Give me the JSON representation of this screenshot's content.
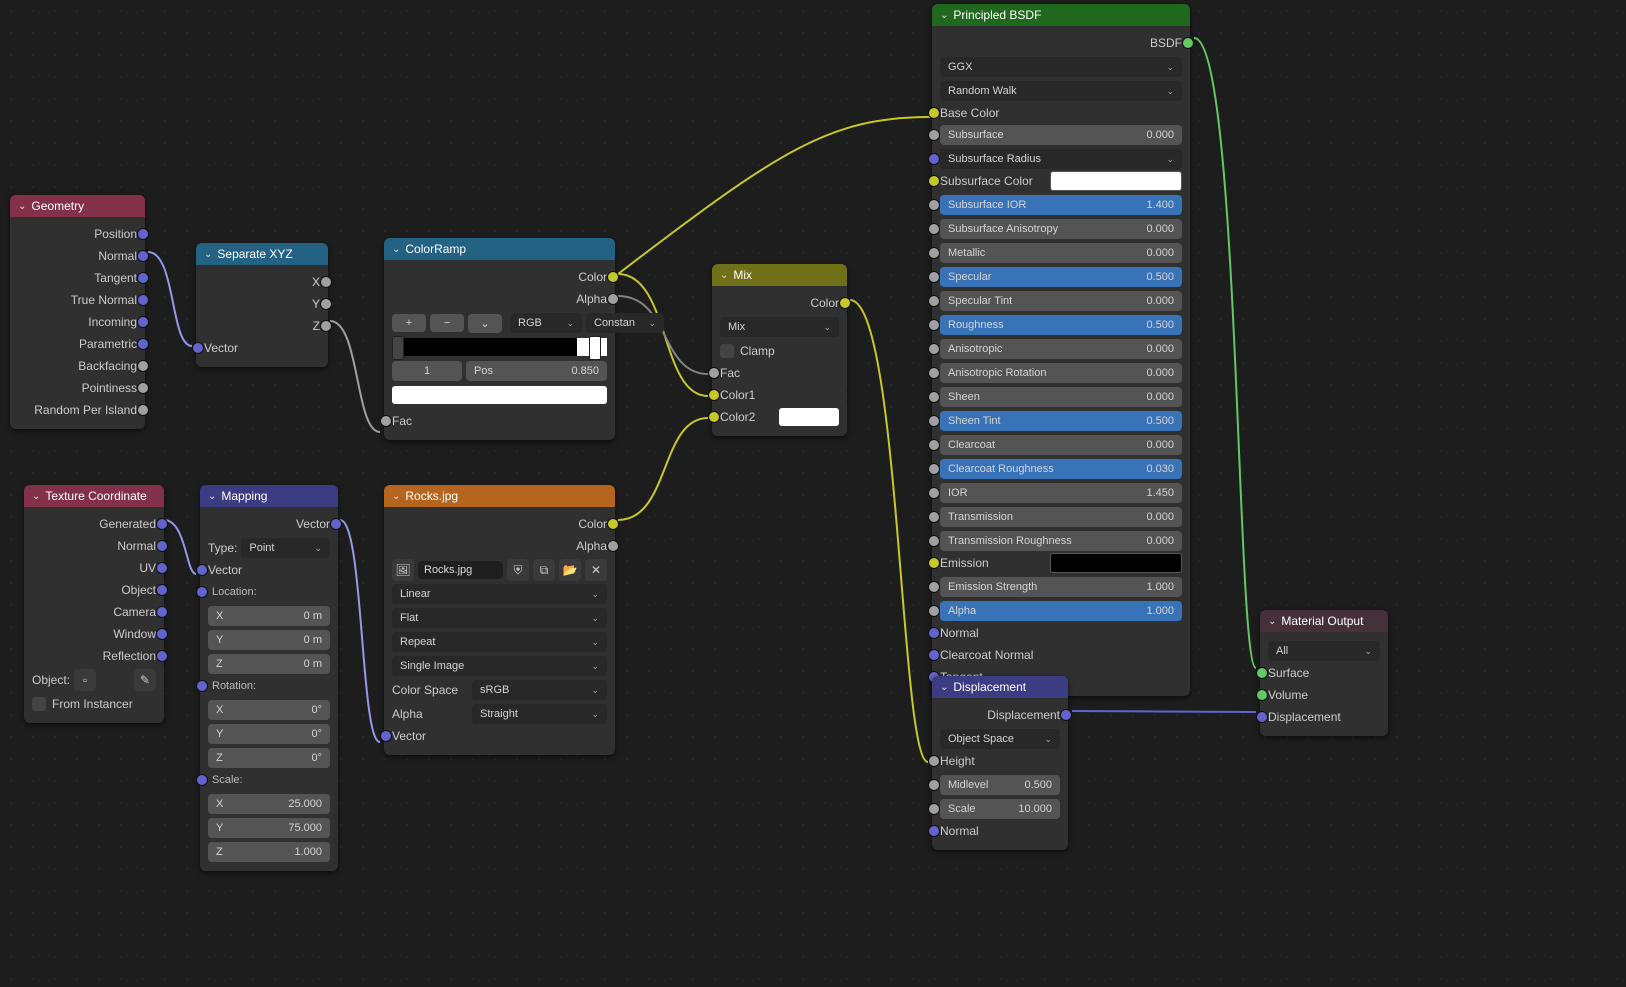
{
  "geometry": {
    "title": "Geometry",
    "outputs": [
      "Position",
      "Normal",
      "Tangent",
      "True Normal",
      "Incoming",
      "Parametric",
      "Backfacing",
      "Pointiness",
      "Random Per Island"
    ]
  },
  "separate_xyz": {
    "title": "Separate XYZ",
    "outputs": [
      "X",
      "Y",
      "Z"
    ],
    "input": "Vector"
  },
  "colorramp": {
    "title": "ColorRamp",
    "out_color": "Color",
    "out_alpha": "Alpha",
    "mode": "RGB",
    "interp": "Constan",
    "index": "1",
    "pos_label": "Pos",
    "pos": "0.850",
    "fac": "Fac",
    "plus": "+",
    "minus": "−",
    "dd": "⌄"
  },
  "mix": {
    "title": "Mix",
    "out_color": "Color",
    "blend": "Mix",
    "clamp": "Clamp",
    "fac": "Fac",
    "c1": "Color1",
    "c2": "Color2"
  },
  "texcoord": {
    "title": "Texture Coordinate",
    "outputs": [
      "Generated",
      "Normal",
      "UV",
      "Object",
      "Camera",
      "Window",
      "Reflection"
    ],
    "object_label": "Object:",
    "from_instancer": "From Instancer"
  },
  "mapping": {
    "title": "Mapping",
    "vector_out": "Vector",
    "type_label": "Type:",
    "type": "Point",
    "vector_in": "Vector",
    "loc_label": "Location:",
    "loc": [
      [
        "X",
        "0 m"
      ],
      [
        "Y",
        "0 m"
      ],
      [
        "Z",
        "0 m"
      ]
    ],
    "rot_label": "Rotation:",
    "rot": [
      [
        "X",
        "0°"
      ],
      [
        "Y",
        "0°"
      ],
      [
        "Z",
        "0°"
      ]
    ],
    "scale_label": "Scale:",
    "scale": [
      [
        "X",
        "25.000"
      ],
      [
        "Y",
        "75.000"
      ],
      [
        "Z",
        "1.000"
      ]
    ]
  },
  "image": {
    "title": "Rocks.jpg",
    "out_color": "Color",
    "out_alpha": "Alpha",
    "filename": "Rocks.jpg",
    "interp": "Linear",
    "projection": "Flat",
    "extension": "Repeat",
    "source": "Single Image",
    "cs_label": "Color Space",
    "cs": "sRGB",
    "alpha_label": "Alpha",
    "alpha_mode": "Straight",
    "vector": "Vector"
  },
  "bsdf": {
    "title": "Principled BSDF",
    "out": "BSDF",
    "dist": "GGX",
    "sss": "Random Walk",
    "base_color": "Base Color",
    "subsurface": [
      "Subsurface",
      "0.000"
    ],
    "ss_radius": "Subsurface Radius",
    "ss_color": "Subsurface Color",
    "ss_ior": [
      "Subsurface IOR",
      "1.400"
    ],
    "ss_aniso": [
      "Subsurface Anisotropy",
      "0.000"
    ],
    "metallic": [
      "Metallic",
      "0.000"
    ],
    "specular": [
      "Specular",
      "0.500"
    ],
    "spec_tint": [
      "Specular Tint",
      "0.000"
    ],
    "roughness": [
      "Roughness",
      "0.500"
    ],
    "aniso": [
      "Anisotropic",
      "0.000"
    ],
    "aniso_rot": [
      "Anisotropic Rotation",
      "0.000"
    ],
    "sheen": [
      "Sheen",
      "0.000"
    ],
    "sheen_tint": [
      "Sheen Tint",
      "0.500"
    ],
    "clearcoat": [
      "Clearcoat",
      "0.000"
    ],
    "cc_rough": [
      "Clearcoat Roughness",
      "0.030"
    ],
    "ior": [
      "IOR",
      "1.450"
    ],
    "transmission": [
      "Transmission",
      "0.000"
    ],
    "trans_rough": [
      "Transmission Roughness",
      "0.000"
    ],
    "emission": "Emission",
    "emit_str": [
      "Emission Strength",
      "1.000"
    ],
    "alpha": [
      "Alpha",
      "1.000"
    ],
    "normal": "Normal",
    "cc_normal": "Clearcoat Normal",
    "tangent": "Tangent"
  },
  "displacement": {
    "title": "Displacement",
    "out": "Displacement",
    "space": "Object Space",
    "height": "Height",
    "midlevel": [
      "Midlevel",
      "0.500"
    ],
    "scale": [
      "Scale",
      "10.000"
    ],
    "normal": "Normal"
  },
  "material_output": {
    "title": "Material Output",
    "target": "All",
    "surface": "Surface",
    "volume": "Volume",
    "disp": "Displacement"
  }
}
